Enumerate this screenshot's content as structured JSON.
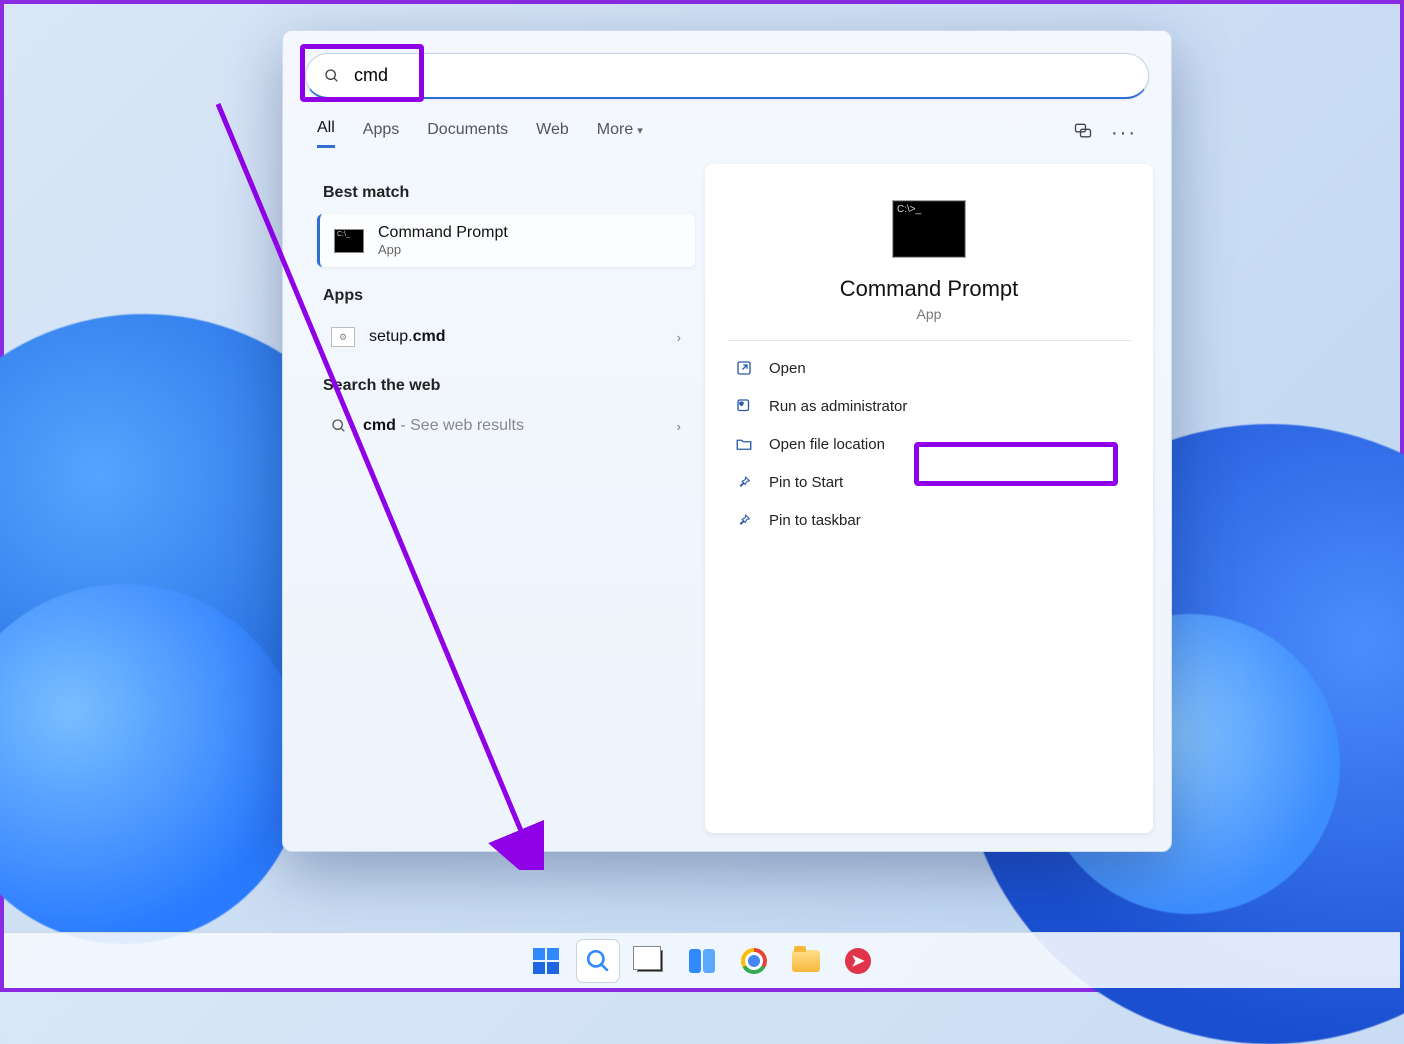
{
  "search": {
    "value": "cmd"
  },
  "filters": {
    "tabs": [
      "All",
      "Apps",
      "Documents",
      "Web"
    ],
    "more": "More"
  },
  "sections": {
    "best_match": "Best match",
    "apps": "Apps",
    "search_web": "Search the web"
  },
  "results": {
    "best": {
      "title": "Command Prompt",
      "subtitle": "App"
    },
    "app1_prefix": "setup.",
    "app1_bold": "cmd",
    "web_bold": "cmd",
    "web_suffix": " - See web results"
  },
  "detail": {
    "title": "Command Prompt",
    "subtitle": "App",
    "actions": {
      "open": "Open",
      "admin": "Run as administrator",
      "location": "Open file location",
      "pin_start": "Pin to Start",
      "pin_taskbar": "Pin to taskbar"
    }
  }
}
